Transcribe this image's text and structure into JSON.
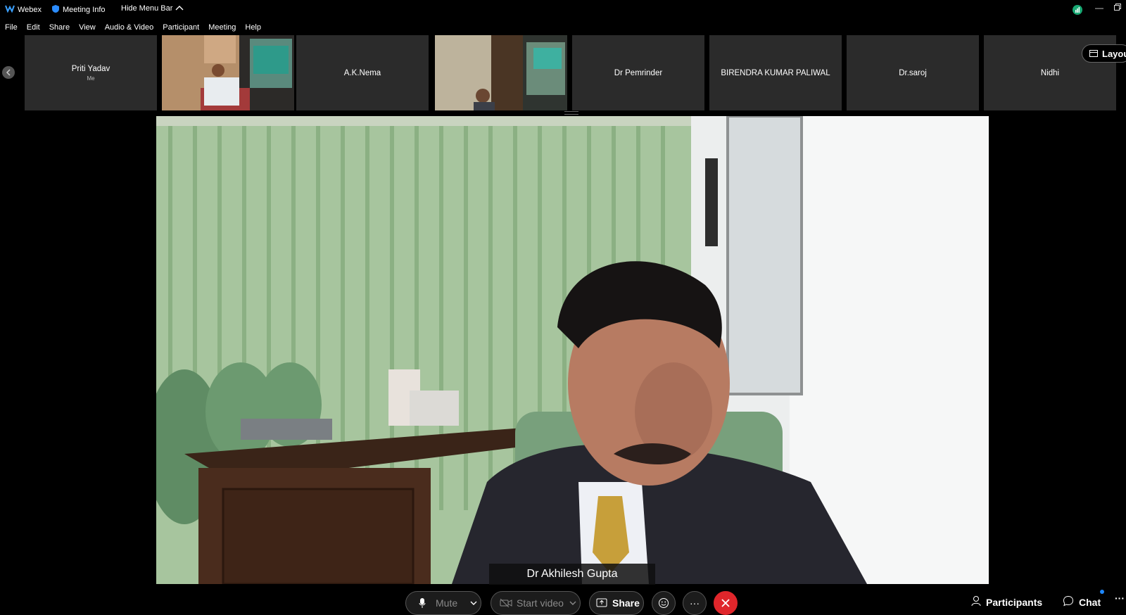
{
  "titlebar": {
    "app_name": "Webex",
    "meeting_info": "Meeting Info",
    "hide_menu_bar": "Hide Menu Bar"
  },
  "menubar": {
    "items": [
      "File",
      "Edit",
      "Share",
      "View",
      "Audio & Video",
      "Participant",
      "Meeting",
      "Help"
    ]
  },
  "filmstrip": {
    "tiles": [
      {
        "name": "Priti Yadav",
        "sub": "Me"
      },
      {
        "name": "",
        "sub": ""
      },
      {
        "name": "A.K.Nema",
        "sub": ""
      },
      {
        "name": "",
        "sub": ""
      },
      {
        "name": "Dr Pemrinder",
        "sub": ""
      },
      {
        "name": "BIRENDRA KUMAR PALIWAL",
        "sub": ""
      },
      {
        "name": "Dr.saroj",
        "sub": ""
      },
      {
        "name": "Nidhi",
        "sub": ""
      }
    ],
    "layout_label": "Layou"
  },
  "main": {
    "speaker_name": "Dr Akhilesh Gupta"
  },
  "controls": {
    "mute": "Mute",
    "start_video": "Start video",
    "share": "Share",
    "more": "···",
    "participants": "Participants",
    "chat": "Chat",
    "overflow": "···"
  },
  "colors": {
    "end_call": "#e0262b",
    "accent": "#1e88ff",
    "tile_bg": "#2b2b2b",
    "curtain_green": "#a8c79f"
  }
}
